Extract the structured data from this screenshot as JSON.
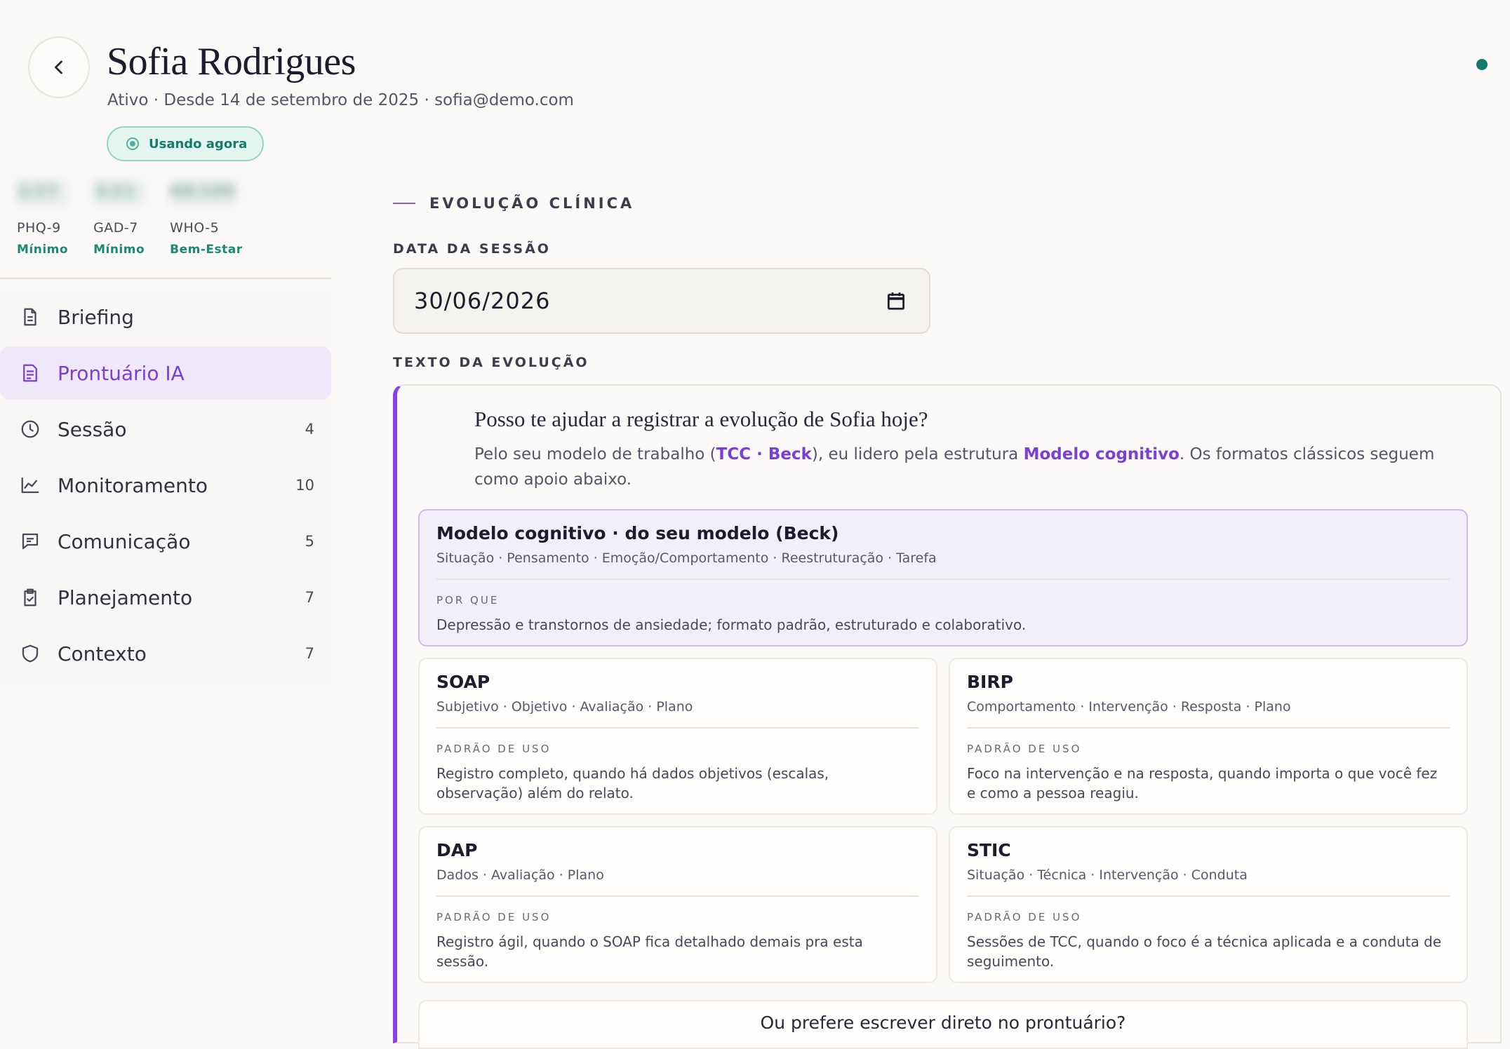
{
  "patient": {
    "name": "Sofia Rodrigues",
    "meta": "Ativo · Desde 14 de setembro de 2025 · sofia@demo.com",
    "status": "Usando agora"
  },
  "scores": [
    {
      "name": "PHQ-9",
      "value": "2/27",
      "level": "Mínimo"
    },
    {
      "name": "GAD-7",
      "value": "3/21",
      "level": "Mínimo"
    },
    {
      "name": "WHO-5",
      "value": "68/100",
      "level": "Bem-Estar"
    }
  ],
  "nav": [
    {
      "label": "Briefing",
      "count": "",
      "icon": "document-icon"
    },
    {
      "label": "Prontuário IA",
      "count": "",
      "icon": "record-icon",
      "active": true
    },
    {
      "label": "Sessão",
      "count": "4",
      "icon": "clock-icon"
    },
    {
      "label": "Monitoramento",
      "count": "10",
      "icon": "chart-icon"
    },
    {
      "label": "Comunicação",
      "count": "5",
      "icon": "message-icon"
    },
    {
      "label": "Planejamento",
      "count": "7",
      "icon": "clipboard-check-icon"
    },
    {
      "label": "Contexto",
      "count": "7",
      "icon": "shield-icon"
    }
  ],
  "main": {
    "section_title": "EVOLUÇÃO CLÍNICA",
    "date_label": "DATA DA SESSÃO",
    "date_value": "30/06/2026",
    "text_label": "TEXTO DA EVOLUÇÃO",
    "question": "Posso te ajudar a registrar a evolução de Sofia hoje?",
    "desc_prefix": "Pelo seu modelo de trabalho (",
    "desc_model": "TCC · Beck",
    "desc_mid": "), eu lidero pela estrutura ",
    "desc_structure": "Modelo cognitivo",
    "desc_suffix": ". Os formatos clássicos seguem como apoio abaixo.",
    "featured": {
      "title": "Modelo cognitivo · do seu modelo (Beck)",
      "sub": "Situação · Pensamento · Emoção/Comportamento · Reestruturação · Tarefa",
      "key": "POR QUE",
      "value": "Depressão e transtornos de ansiedade; formato padrão, estruturado e colaborativo."
    },
    "formats": [
      {
        "title": "SOAP",
        "sub": "Subjetivo · Objetivo · Avaliação · Plano",
        "key": "PADRÃO DE USO",
        "value": "Registro completo, quando há dados objetivos (escalas, observação) além do relato."
      },
      {
        "title": "BIRP",
        "sub": "Comportamento · Intervenção · Resposta · Plano",
        "key": "PADRÃO DE USO",
        "value": "Foco na intervenção e na resposta, quando importa o que você fez e como a pessoa reagiu."
      },
      {
        "title": "DAP",
        "sub": "Dados · Avaliação · Plano",
        "key": "PADRÃO DE USO",
        "value": "Registro ágil, quando o SOAP fica detalhado demais pra esta sessão."
      },
      {
        "title": "STIC",
        "sub": "Situação · Técnica · Intervenção · Conduta",
        "key": "PADRÃO DE USO",
        "value": "Sessões de TCC, quando o foco é a técnica aplicada e a conduta de seguimento."
      }
    ],
    "direct_prompt": "Ou prefere escrever direto no prontuário?"
  },
  "colors": {
    "accent": "#7b3fd6",
    "teal": "#157d6c",
    "background": "#faf9f7"
  }
}
